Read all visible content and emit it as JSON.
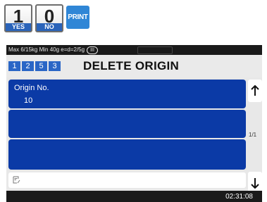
{
  "keys": {
    "one": {
      "digit": "1",
      "label": "YES"
    },
    "zero": {
      "digit": "0",
      "label": "NO"
    },
    "print": {
      "label": "PRINT"
    }
  },
  "status": {
    "spec": "Max 6/15kg Min 40g e=d=2/5g",
    "class": "III"
  },
  "header": {
    "codes": [
      "1",
      "2",
      "5",
      "3"
    ],
    "code_color": "#2a66c6",
    "title": "DELETE ORIGIN"
  },
  "list": {
    "row_color": "#0b3aa6",
    "rows": [
      {
        "label": "Origin No.",
        "value": "10"
      },
      {
        "label": "",
        "value": ""
      },
      {
        "label": "",
        "value": ""
      }
    ]
  },
  "scroll": {
    "up_icon": "arrow-up-icon",
    "down_icon": "arrow-down-icon",
    "page_indicator": "1/1"
  },
  "input": {
    "icon": "edit-icon",
    "value": ""
  },
  "footer": {
    "time": "02:31:08"
  }
}
